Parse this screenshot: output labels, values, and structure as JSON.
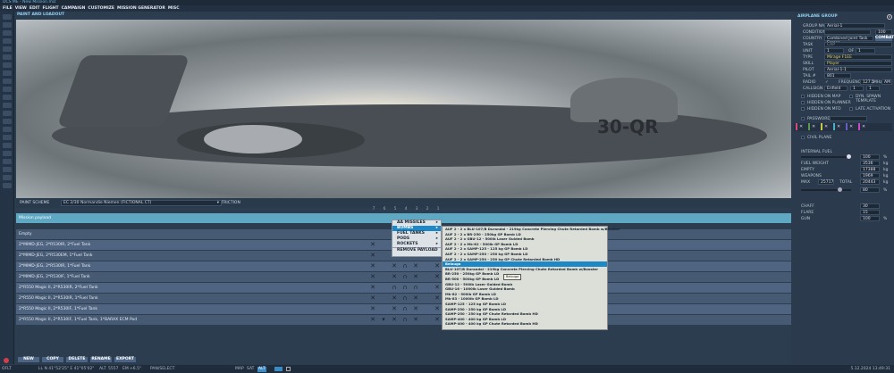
{
  "window": {
    "title": "DCS ME - New Mission.miz"
  },
  "menu": [
    "FILE",
    "VIEW",
    "EDIT",
    "FLIGHT",
    "CAMPAIGN",
    "CUSTOMIZE",
    "MISSION GENERATOR",
    "MISC"
  ],
  "panel_title": "PAINT AND LOADOUT",
  "aircraft_marking": "30-QR",
  "paint_scheme": {
    "label": "PAINT SCHEME",
    "value": "EC 2/30 Normandie Niemen (FICTIONAL CT)",
    "restriction_label": "PAYLOAD RESTRICTION"
  },
  "mission_payload": "Mission payload",
  "pylons": [
    "7",
    "6",
    "5",
    "4",
    "3",
    "2",
    "1"
  ],
  "payload_rows": [
    "Empty",
    "2*MIMD-JEG, 2*R530IR, 2*Fuel Tank",
    "2*MIMD-JEG, 2*R530EM, 1*Fuel Tank",
    "2*MIMD-JEG, 2*R530IR, 1*Fuel Tank",
    "2*MIMD-JEG, 2*R530IF, 1*Fuel Tank",
    "2*R550 Magic II, 2*R530IR, 2*Fuel Tank",
    "2*R550 Magic II, 2*R530IR, 1*Fuel Tank",
    "2*R550 Magic II, 2*R530IF, 1*Fuel Tank",
    "2*R550 Magic II, 2*R530IF, 1*Fuel Tank, 1*BARAX ECM Pod"
  ],
  "context_menu": [
    {
      "label": "AA MISSILES",
      "sub": true
    },
    {
      "label": "BOMBS",
      "sub": true,
      "selected": true
    },
    {
      "label": "FUEL TANKS",
      "sub": true
    },
    {
      "label": "PODS",
      "sub": true
    },
    {
      "label": "ROCKETS",
      "sub": true
    },
    {
      "label": "REMOVE PAYLOAD",
      "sub": false
    }
  ],
  "bombs_menu": [
    "AUF 2 - 2 x BLU-107/B Durandal - 219kg Concrete Piercing Chute Retarded Bomb w/Booster",
    "AUF 2 - 2 x BR-250 - 250kg GP Bomb LD",
    "AUF 2 - 2 x GBU-12 - 500lb Laser Guided Bomb",
    "AUF 2 - 2 x Mk-82 - 500lb GP Bomb LD",
    "AUF 2 - 2 x SAMP-125 - 125 kg GP Bomb LD",
    "AUF 2 - 2 x SAMP-250 - 250 kg GP Bomb LD",
    "AUF 2 - 2 x SAMP-250 - 250 kg GP Chute Retarded Bomb HD",
    "Belouga",
    "BLU-107/B Durandal - 219kg Concrete Piercing Chute Retarded Bomb w/Booster",
    "BR-250 - 250kg GP Bomb LD",
    "BR-500 - 500kg GP Bomb LD",
    "GBU-12 - 500lb Laser Guided Bomb",
    "GBU-16 - 1000lb Laser Guided Bomb",
    "Mk-82 - 500lb GP Bomb LD",
    "Mk-83 - 1000lb GP Bomb LD",
    "SAMP-125 - 125 kg GP Bomb LD",
    "SAMP-250 - 250 kg GP Bomb LD",
    "SAMP-250 - 250 kg GP Chute Retarded Bomb HD",
    "SAMP-400 - 400 kg GP Bomb LD",
    "SAMP-400 - 400 kg GP Chute Retarded Bomb HD"
  ],
  "bombs_selected_index": 7,
  "tooltip": "Belouga",
  "buttons": [
    "NEW",
    "COPY",
    "DELETE",
    "RENAME",
    "EXPORT"
  ],
  "status": {
    "mode": "OFLT",
    "coords": "LL  N 41°52'25\"  E 41°05'02\"",
    "alt_label": "ALT",
    "alt": "5557",
    "em_label": "EM",
    "em": "+6.5°",
    "action": "PAN/SELECT",
    "map_buttons": [
      "MAP",
      "SAT",
      "ALT"
    ],
    "datetime": "5.12.2024 13:49:31"
  },
  "group": {
    "title": "AIRPLANE GROUP",
    "group_name_label": "GROUP NAME",
    "group_name": "Aerial-1",
    "condition_label": "CONDITION",
    "condition": "100",
    "country_label": "COUNTRY",
    "country": "Combined Joint Task Forces",
    "combat": "COMBAT",
    "task_label": "TASK",
    "task": "CAP",
    "unit_label": "UNIT",
    "unit": "1",
    "of_label": "OF",
    "of": "1",
    "type_label": "TYPE",
    "type": "Mirage F1EE",
    "skill_label": "SKILL",
    "skill": "Player",
    "pilot_label": "PILOT",
    "pilot": "Aerial-1-1",
    "tail_label": "TAIL #",
    "tail": "801",
    "radio_label": "RADIO",
    "frequency_label": "FREQUENCY",
    "frequency": "127.5",
    "mhz": "MHz",
    "modulation": "AM",
    "callsign_label": "CALLSIGN",
    "callsign": "Enfield",
    "callsign_n1": "1",
    "callsign_n2": "1",
    "checks": [
      "HIDDEN ON MAP",
      "DYN. SPAWN TEMPLATE",
      "HIDDEN ON PLANNER",
      "HIDDEN ON MFD",
      "LATE ACTIVATION"
    ],
    "password_label": "PASSWORD",
    "civil_plane": "CIVIL PLANE",
    "internal_fuel_label": "INTERNAL FUEL",
    "internal_fuel_pct": 100,
    "internal_fuel": "100",
    "fuel_weight_label": "FUEL WEIGHT",
    "fuel_weight": "3536",
    "empty_label": "EMPTY",
    "empty": "17388",
    "weapons_label": "WEAPONS",
    "weapons": "1969",
    "max_label": "MAX",
    "max": "25717",
    "total_label": "TOTAL",
    "total": "20443",
    "ballast": "80",
    "ballast_pct": 80,
    "chaff_label": "CHAFF",
    "chaff": "30",
    "flare_label": "FLARE",
    "flare": "15",
    "gun_label": "GUN",
    "gun": "100",
    "unit_pct": "%",
    "unit_kg": "kg",
    "stripe_colors": [
      "#d04a7a",
      "#5a9a4a",
      "#c8c84a",
      "#4ab0c8",
      "#6a5ac8",
      "#c84ac8"
    ]
  }
}
